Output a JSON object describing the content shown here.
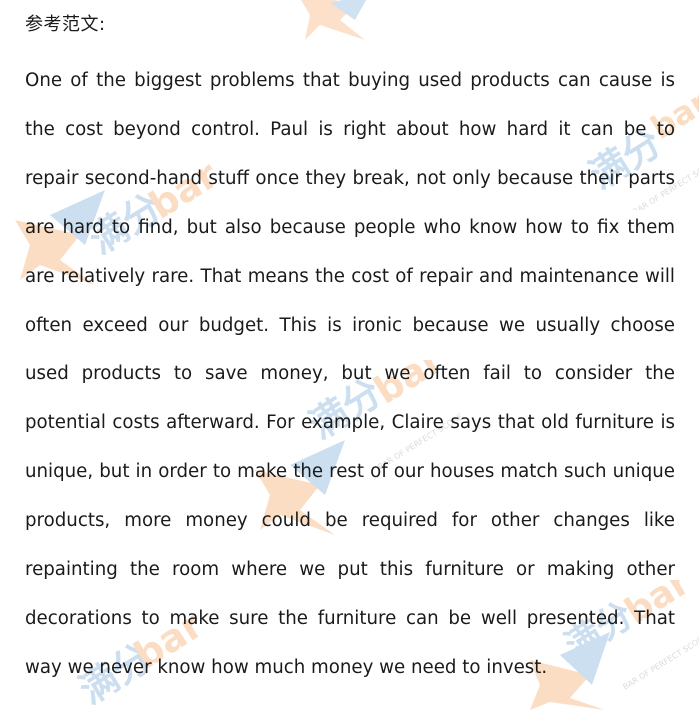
{
  "document": {
    "heading": "参考范文:",
    "body": "One of the biggest problems that buying used products can cause is the cost beyond control. Paul is right about how hard it can be to repair second-hand stuff once they break, not only because their parts are hard to find, but also because people who know how to fix them are relatively rare. That means the cost of repair and maintenance will often exceed our budget. This is ironic because we usually choose used products to save money, but we often fail to consider the potential costs afterward. For example, Claire says that old furniture is unique, but in order to make the rest of our houses match such unique products, more money could be required for other changes like repainting the room where we put this furniture or making other decorations to make sure the furniture can be well presented. That way we never know how much money we need to invest."
  },
  "watermark": {
    "brand_cn": "满分",
    "brand_en": "bar",
    "tagline": "BAR OF PERFECT SCORE",
    "colors": {
      "orange": "#f6a15a",
      "blue": "#6fa4d6"
    }
  }
}
